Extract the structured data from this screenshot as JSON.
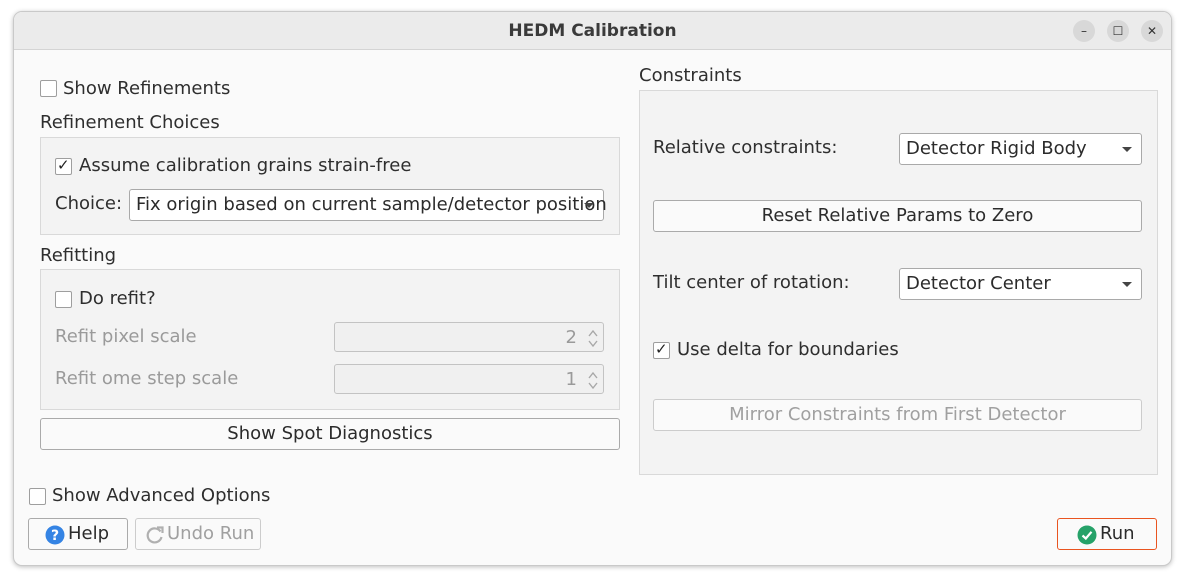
{
  "window": {
    "title": "HEDM Calibration",
    "controls": {
      "minimize": "–",
      "maximize": "☐",
      "close": "✕"
    }
  },
  "left": {
    "show_refinements": {
      "label": "Show Refinements",
      "checked": false
    },
    "refinement_choices": {
      "title": "Refinement Choices",
      "strain_free": {
        "label": "Assume calibration grains strain-free",
        "checked": true
      },
      "choice_label": "Choice:",
      "choice_value": "Fix origin based on current sample/detector position"
    },
    "refitting": {
      "title": "Refitting",
      "do_refit": {
        "label": "Do refit?",
        "checked": false
      },
      "pixel_scale_label": "Refit pixel scale",
      "pixel_scale_value": "2",
      "ome_step_label": "Refit ome step scale",
      "ome_step_value": "1"
    },
    "spot_diagnostics": "Show Spot Diagnostics"
  },
  "constraints": {
    "title": "Constraints",
    "relative_label": "Relative constraints:",
    "relative_value": "Detector Rigid Body",
    "reset_button": "Reset Relative Params to Zero",
    "tilt_label": "Tilt center of rotation:",
    "tilt_value": "Detector Center",
    "use_delta": {
      "label": "Use delta for boundaries",
      "checked": true
    },
    "mirror_button": "Mirror Constraints from First Detector"
  },
  "bottom": {
    "show_advanced": {
      "label": "Show Advanced Options",
      "checked": false
    },
    "help": "Help",
    "undo": "Undo Run",
    "run": "Run"
  },
  "colors": {
    "accent": "#e95420",
    "help_icon": "#3584e4",
    "run_icon": "#26a269"
  }
}
